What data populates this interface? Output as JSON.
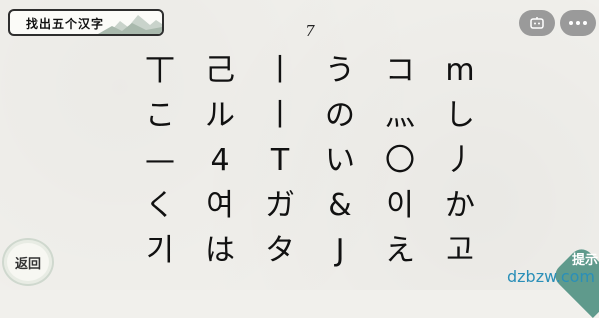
{
  "header": {
    "title": "找出五个汉字",
    "counter": "7",
    "robot_icon": "robot-icon",
    "more_icon": "more-dots-icon"
  },
  "grid": {
    "rows": [
      [
        "丅",
        "己",
        "丨",
        "う",
        "コ",
        "m"
      ],
      [
        "こ",
        "ル",
        "丨",
        "の",
        "灬",
        "し"
      ],
      [
        "—",
        "4",
        "T",
        "い",
        "〇",
        "丿"
      ],
      [
        "く",
        "여",
        "ガ",
        "&",
        "이",
        "か"
      ],
      [
        "기",
        "は",
        "タ",
        "J",
        "え",
        "고"
      ]
    ]
  },
  "footer": {
    "back_label": "返回",
    "hint_label": "提示",
    "watermark": "dzbzw.com"
  },
  "colors": {
    "background": "#f1f0ec",
    "button_gray": "#9a9a9a",
    "hint_green": "#5f9a8c",
    "watermark_blue": "#2a8fb8"
  }
}
